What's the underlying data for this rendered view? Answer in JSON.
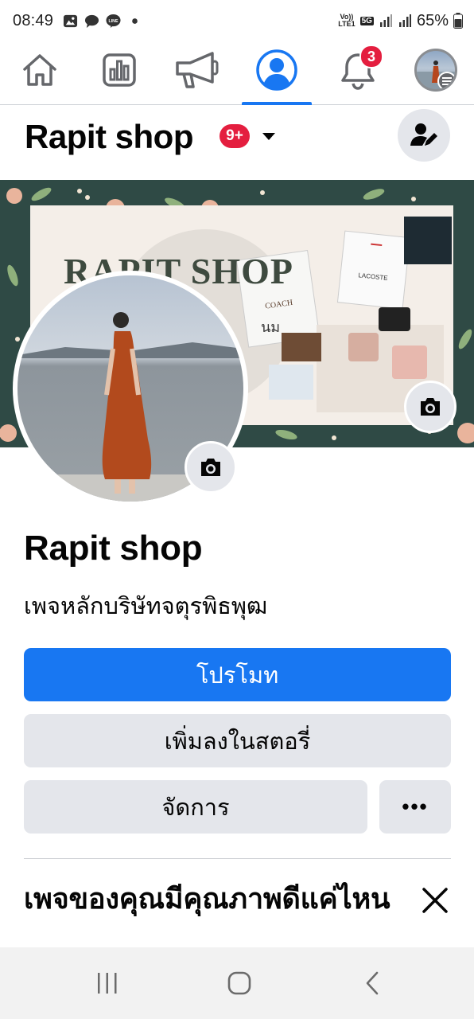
{
  "status_bar": {
    "time": "08:49",
    "network": "VoLTE1",
    "network_type": "5G",
    "battery": "65%",
    "notification_icons": [
      "image-icon",
      "chat-icon",
      "line-icon",
      "dot-icon"
    ]
  },
  "nav": {
    "items": [
      "home-icon",
      "insights-icon",
      "megaphone-icon",
      "profile-icon",
      "notifications-icon",
      "account-avatar"
    ],
    "active_index": 3,
    "notification_count": "3",
    "accent_color": "#1877f2"
  },
  "header": {
    "title": "Rapit shop",
    "badge": "9+"
  },
  "cover": {
    "brand_text": "RAPIT SHOP",
    "thai_text": "นม"
  },
  "profile": {
    "name": "Rapit shop",
    "category": "เพจหลักบริษัทจตุรพิธพุฒ"
  },
  "actions": {
    "promote": "โปรโมท",
    "add_story": "เพิ่มลงในสตอรี่",
    "manage": "จัดการ",
    "more": "•••"
  },
  "quality": {
    "heading": "เพจของคุณมีคุณภาพดีแค่ไหน"
  }
}
